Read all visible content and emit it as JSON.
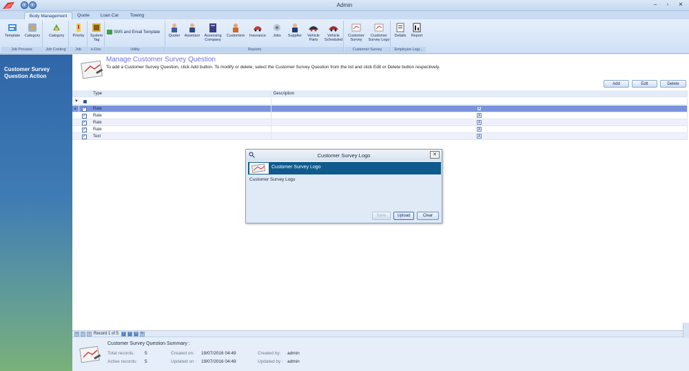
{
  "window": {
    "title": "Admin",
    "controls": [
      "–",
      "▫",
      "✕"
    ]
  },
  "ribbon": {
    "tabs": [
      "Body Management",
      "Quote",
      "Loan Car",
      "Towing"
    ],
    "active_tab": "Body Management",
    "groups": [
      {
        "label": "Job Process",
        "buttons": [
          "Template",
          "Category"
        ]
      },
      {
        "label": "Job Costing",
        "buttons": [
          "Category"
        ]
      },
      {
        "label": "Job",
        "buttons": [
          "Priority"
        ]
      },
      {
        "label": "e-Doc",
        "buttons": [
          "System Tag"
        ]
      },
      {
        "label": "Utility",
        "buttons": [
          "SMS and Email Template"
        ]
      },
      {
        "label": "Reports",
        "buttons": [
          "Quoter",
          "Assessor",
          "Assessing Company",
          "Customers",
          "Insurance",
          "Jobs",
          "Supplier",
          "Vehicle Parts",
          "Vehicle Scheduled"
        ]
      },
      {
        "label": "Customer Survey",
        "buttons": [
          "Customer Survey",
          "Customer Survey Logo"
        ]
      },
      {
        "label": "Employee Logi...",
        "buttons": [
          "Details",
          "Report"
        ]
      }
    ]
  },
  "left_panel": {
    "title": "Customer Survey Question Action"
  },
  "header": {
    "title": "Manage Customer Survey Question",
    "description": "To add a Customer Survey Question, click Add button. To modify or delete, select the Customer Survey Question from the list and click Edit or Delete button respectively."
  },
  "actions": {
    "add": "Add",
    "edit": "Edit",
    "delete": "Delete"
  },
  "grid": {
    "columns": [
      "Type",
      "Description"
    ],
    "rows": [
      {
        "type": "Rate",
        "description": "",
        "selected": true
      },
      {
        "type": "Rate",
        "description": ""
      },
      {
        "type": "Rate",
        "description": ""
      },
      {
        "type": "Rate",
        "description": ""
      },
      {
        "type": "Text",
        "description": ""
      }
    ]
  },
  "dialog": {
    "title": "Customer Survey Logo",
    "banner": "Customer Survey Logo",
    "label": "Customer Survey Logo",
    "buttons": {
      "save": "Save",
      "upload": "Upload",
      "clear": "Clear"
    }
  },
  "pager": {
    "text": "Record 1 of 5"
  },
  "summary": {
    "title": "Customer Survey Question Summary :",
    "total_records_label": "Total records:",
    "total_records": "5",
    "active_records_label": "Active records:",
    "active_records": "5",
    "created_on_label": "Created on:",
    "created_on": "19/07/2016 04:49",
    "updated_on_label": "Updated on :",
    "updated_on": "19/07/2016 04:49",
    "created_by_label": "Created by:",
    "created_by": "admin",
    "updated_by_label": "Updated by :",
    "updated_by": "admin"
  },
  "colors": {
    "heading": "#6f72d8",
    "selected_row": "#7b93dd",
    "dialog_banner": "#0e5a8c"
  }
}
